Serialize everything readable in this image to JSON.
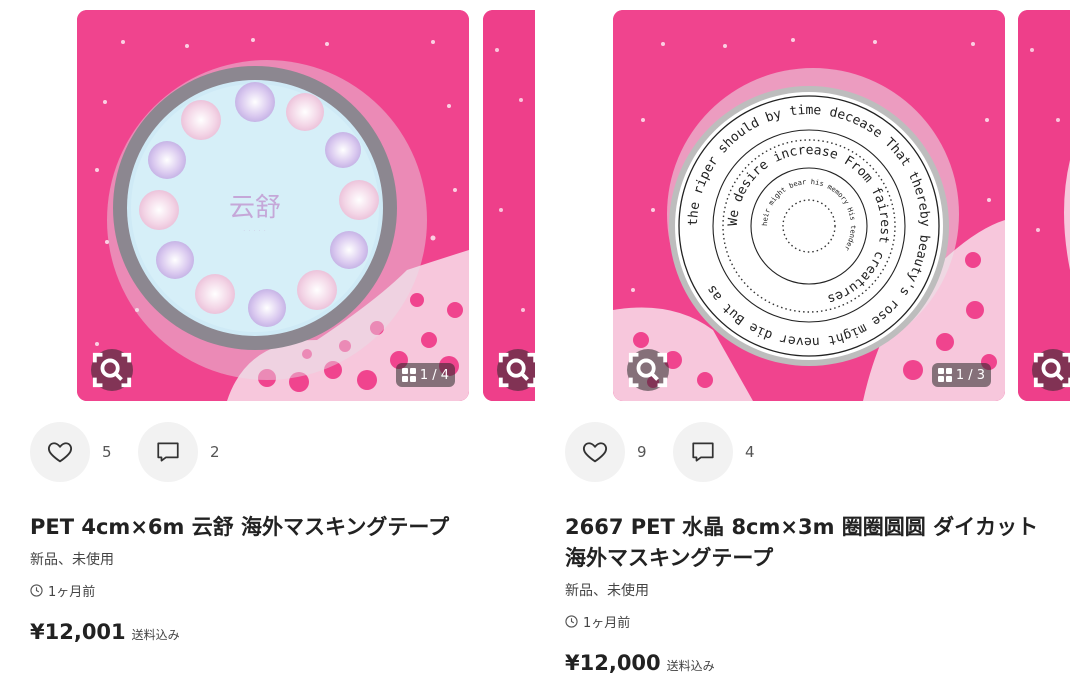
{
  "listings": [
    {
      "image_counter": "1 / 4",
      "likes": "5",
      "comments": "2",
      "title": "PET 4cm×6m 云舒 海外マスキングテープ",
      "condition": "新品、未使用",
      "posted": "1ヶ月前",
      "price": "¥12,001",
      "price_note": "送料込み",
      "image_text": "云舒",
      "background_color": "#f0448e"
    },
    {
      "image_counter": "1 / 3",
      "likes": "9",
      "comments": "4",
      "title": "2667 PET 水晶 8cm×3m 圈圈圆圆 ダイカット 海外マスキングテープ",
      "condition": "新品、未使用",
      "posted": "1ヶ月前",
      "price": "¥12,000",
      "price_note": "送料込み",
      "image_text_rings": [
        "the riper should by time decease That thereby beauty's rose might never die But as",
        "We desire increase From fairest creatures",
        "heir might bear his memory His tender"
      ],
      "background_color": "#f0448e"
    }
  ],
  "icons": {
    "lens": "image-search-icon",
    "heart": "heart-icon",
    "comment": "comment-icon",
    "clock": "clock-icon",
    "grid": "grid-icon"
  }
}
